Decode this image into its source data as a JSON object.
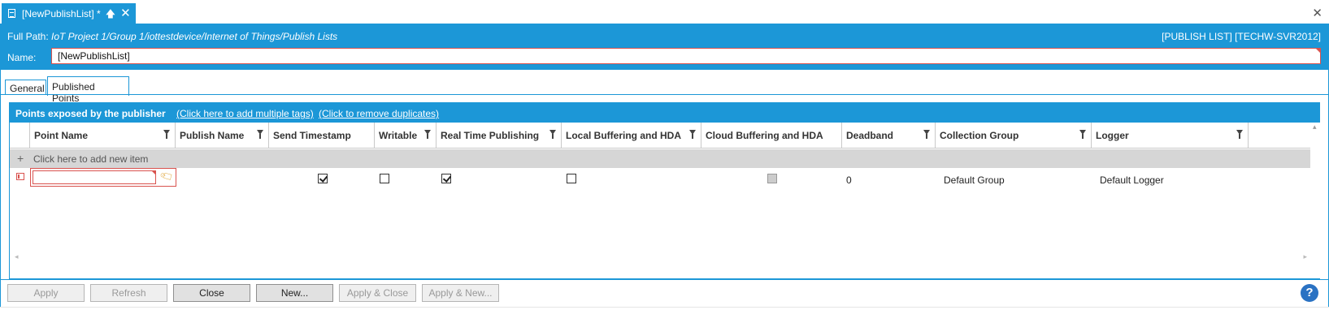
{
  "document_tab": {
    "title": "[NewPublishList] *",
    "pin_icon": "pin-icon",
    "close_icon": "close-icon"
  },
  "window": {
    "close_glyph": "✕"
  },
  "header": {
    "fullpath_label": "Full Path:",
    "fullpath_value": "IoT Project 1/Group 1/iottestdevice/Internet of Things/Publish Lists",
    "publish_info": "[PUBLISH LIST] [TECHW-SVR2012]",
    "name_label": "Name:",
    "name_value": "[NewPublishList]"
  },
  "tabs": [
    {
      "label": "General",
      "active": false
    },
    {
      "label": "Published Points",
      "active": true
    }
  ],
  "panel": {
    "title": "Points exposed by the publisher",
    "link_add_multiple": "(Click here to add multiple tags)",
    "link_remove_duplicates": "(Click to remove duplicates)"
  },
  "grid": {
    "columns": [
      {
        "label": "Point Name",
        "filter": true
      },
      {
        "label": "Publish Name",
        "filter": true
      },
      {
        "label": "Send Timestamp",
        "filter": false
      },
      {
        "label": "Writable",
        "filter": true
      },
      {
        "label": "Real Time Publishing",
        "filter": true
      },
      {
        "label": "Local Buffering and HDA",
        "filter": true
      },
      {
        "label": "Cloud Buffering and HDA",
        "filter": false
      },
      {
        "label": "Deadband",
        "filter": true
      },
      {
        "label": "Collection Group",
        "filter": true
      },
      {
        "label": "Logger",
        "filter": true
      }
    ],
    "add_row_label": "Click here to add new item",
    "row": {
      "point_name": "",
      "publish_name": "",
      "send_timestamp": true,
      "writable": false,
      "real_time_publishing": true,
      "local_buffering": false,
      "cloud_buffering": "indeterminate",
      "deadband": "0",
      "collection_group": "Default Group",
      "logger": "Default Logger"
    }
  },
  "buttons": {
    "apply": "Apply",
    "refresh": "Refresh",
    "close": "Close",
    "new": "New...",
    "apply_close": "Apply & Close",
    "apply_new": "Apply & New..."
  },
  "help": {
    "glyph": "?"
  },
  "colors": {
    "accent": "#1c97d7",
    "error": "#d9534f",
    "help": "#2a72c3"
  }
}
